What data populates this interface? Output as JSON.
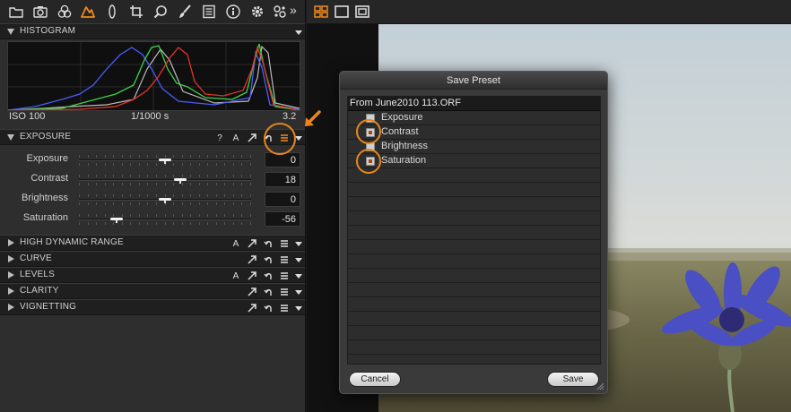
{
  "colors": {
    "accent": "#e8861e",
    "panel_bg": "#2e2e2e",
    "header_bg": "#1f1f1f",
    "histogram_red": "#e0362a",
    "histogram_green": "#3fd14a",
    "histogram_blue": "#4b5cff",
    "histogram_gray": "#bbbbbb"
  },
  "toolbar": {
    "icons": [
      "folder-icon",
      "camera-icon",
      "color-circles-icon",
      "exposure-triangle-icon",
      "lens-icon",
      "crop-icon",
      "magnifier-icon",
      "brush-icon",
      "metadata-icon",
      "info-icon",
      "gear-icon",
      "adjustments-icon"
    ],
    "more_label": "»"
  },
  "histogram": {
    "title": "HISTOGRAM",
    "iso": "ISO 100",
    "shutter": "1/1000 s",
    "aperture": "3.2"
  },
  "exposure": {
    "title": "EXPOSURE",
    "header_icons": {
      "help": "?",
      "auto": "A"
    },
    "sliders": [
      {
        "label": "Exposure",
        "value": "0",
        "min": -100,
        "max": 100,
        "level": 0
      },
      {
        "label": "Contrast",
        "value": "18",
        "min": -100,
        "max": 100,
        "level": 18
      },
      {
        "label": "Brightness",
        "value": "0",
        "min": -100,
        "max": 100,
        "level": 0
      },
      {
        "label": "Saturation",
        "value": "-56",
        "min": -100,
        "max": 100,
        "level": -56
      }
    ]
  },
  "collapsed_tools": [
    {
      "title": "HIGH DYNAMIC RANGE",
      "has_auto": true,
      "auto": "A"
    },
    {
      "title": "CURVE",
      "has_auto": false
    },
    {
      "title": "LEVELS",
      "has_auto": true,
      "auto": "A"
    },
    {
      "title": "CLARITY",
      "has_auto": false
    },
    {
      "title": "VIGNETTING",
      "has_auto": false
    }
  ],
  "viewer": {
    "icons": [
      "grid-view-icon",
      "single-view-icon",
      "fit-view-icon"
    ]
  },
  "dialog": {
    "title": "Save Preset",
    "source_name": "From June2010 113.ORF",
    "items": [
      {
        "label": "Exposure",
        "checked": false
      },
      {
        "label": "Contrast",
        "checked": true
      },
      {
        "label": "Brightness",
        "checked": false
      },
      {
        "label": "Saturation",
        "checked": true
      }
    ],
    "cancel_label": "Cancel",
    "save_label": "Save"
  }
}
